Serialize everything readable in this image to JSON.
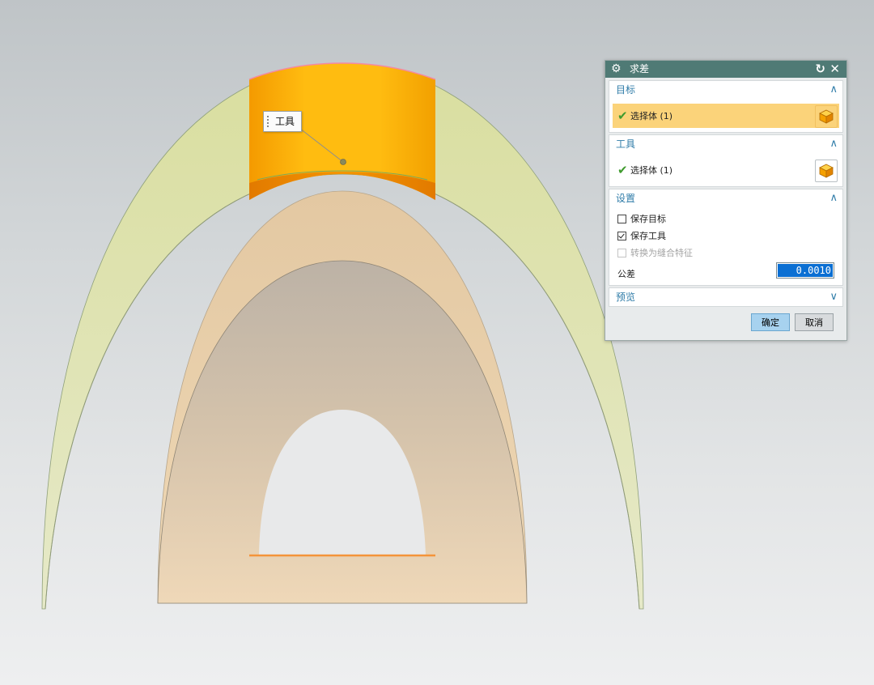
{
  "viewport": {
    "tool_tag": "工具",
    "colors": {
      "tool_body": "#f6a800",
      "shell": "#d8dfa6",
      "inner": "#ecd3ad"
    }
  },
  "dialog": {
    "title": "求差",
    "sections": {
      "target": {
        "title": "目标",
        "select_label": "选择体 (1)",
        "expanded": true
      },
      "tool": {
        "title": "工具",
        "select_label": "选择体 (1)",
        "expanded": true
      },
      "settings": {
        "title": "设置",
        "expanded": true,
        "options": [
          {
            "label": "保存目标",
            "checked": false,
            "enabled": true
          },
          {
            "label": "保存工具",
            "checked": true,
            "enabled": true
          },
          {
            "label": "转换为缝合特征",
            "checked": false,
            "enabled": false
          }
        ],
        "tolerance_label": "公差",
        "tolerance_value": "0.0010"
      },
      "preview": {
        "title": "预览",
        "expanded": false
      }
    },
    "ok_label": "确定",
    "cancel_label": "取消",
    "accent": "#4f7a75"
  }
}
